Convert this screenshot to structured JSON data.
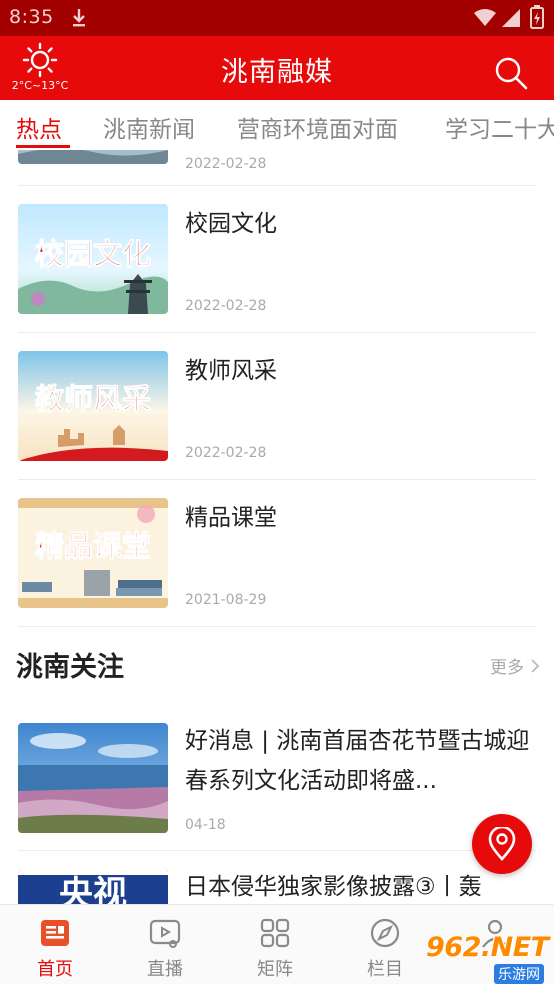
{
  "status_bar": {
    "time": "8:35"
  },
  "header": {
    "title": "洮南融媒",
    "weather_temp": "2°C~13°C",
    "search_icon": "search-icon",
    "weather_icon": "sun-icon"
  },
  "tabs": [
    {
      "label": "热点",
      "active": true
    },
    {
      "label": "洮南新闻",
      "active": false
    },
    {
      "label": "营商环境面对面",
      "active": false
    },
    {
      "label": "学习二十大",
      "active": false
    }
  ],
  "feed_top": [
    {
      "title": "",
      "date": "2022-02-28"
    },
    {
      "title": "校园文化",
      "date": "2022-02-28",
      "thumb_text": "校园文化"
    },
    {
      "title": "教师风采",
      "date": "2022-02-28",
      "thumb_text": "教师风采"
    },
    {
      "title": "精品课堂",
      "date": "2021-08-29",
      "thumb_text": "精品课堂"
    }
  ],
  "section": {
    "title": "洮南关注",
    "more_label": "更多"
  },
  "feed_focus": [
    {
      "title": "好消息 | 洮南首届杏花节暨古城迎春系列文化活动即将盛...",
      "date": "04-18"
    },
    {
      "title": "日本侵华独家影像披露③丨轰",
      "thumb_text": "央视"
    }
  ],
  "bottom_nav": [
    {
      "label": "首页",
      "icon": "home-icon",
      "active": true
    },
    {
      "label": "直播",
      "icon": "live-icon",
      "active": false
    },
    {
      "label": "矩阵",
      "icon": "grid-icon",
      "active": false
    },
    {
      "label": "栏目",
      "icon": "compass-icon",
      "active": false
    },
    {
      "label": "",
      "icon": "user-icon",
      "active": false
    }
  ],
  "watermark": {
    "main": "962.NET",
    "sub": "乐游网"
  },
  "colors": {
    "brand_red": "#e60a0a",
    "status_bar": "#a30000"
  }
}
